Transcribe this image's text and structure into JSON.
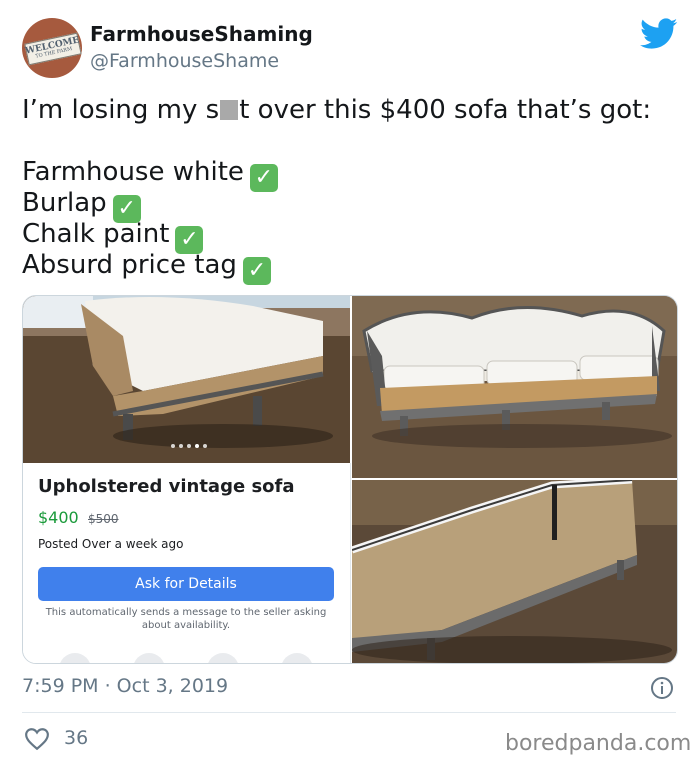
{
  "header": {
    "display_name": "FarmhouseShaming",
    "handle": "@FarmhouseShame",
    "avatar": {
      "sign_line1": "WELCOME",
      "sign_line2": "TO THE FARM"
    }
  },
  "tweet": {
    "line1_before": "I’m losing my s",
    "line1_after": "t over this $400 sofa that’s got:",
    "list": [
      {
        "text": "Farmhouse white"
      },
      {
        "text": "Burlap"
      },
      {
        "text": "Chalk paint"
      },
      {
        "text": "Absurd price tag"
      }
    ],
    "check_glyph": "✓"
  },
  "listing": {
    "title": "Upholstered vintage sofa",
    "price": "$400",
    "old_price": "$500",
    "posted": "Posted Over a week ago",
    "button_label": "Ask for Details",
    "note": "This automatically sends a message to the seller asking about availability."
  },
  "footer": {
    "timestamp": "7:59 PM · Oct 3, 2019",
    "likes": "36",
    "watermark": "boredpanda.com"
  },
  "colors": {
    "twitter_blue": "#1da1f2",
    "button_blue": "#4080ec",
    "check_green": "#5cb85c",
    "price_green": "#1a9a3a"
  },
  "icons": [
    "twitter-bird-icon",
    "info-icon",
    "heart-icon",
    "check-icon"
  ]
}
